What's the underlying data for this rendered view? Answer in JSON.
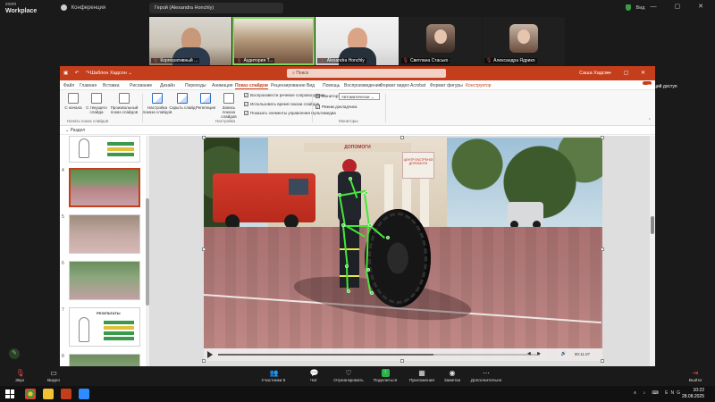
{
  "zoom": {
    "logo_line1": "zoom",
    "logo_line2": "Workplace",
    "conference_label": "Конференция",
    "speaker_label": "Герой (Alexandra Honchly)",
    "view_label": "Вид",
    "participants": [
      {
        "name": "Корпоративный ...",
        "type": "video"
      },
      {
        "name": "Аудитория Т...",
        "type": "video"
      },
      {
        "name": "Alexandra Honchly",
        "type": "video"
      },
      {
        "name": "Светлана Стасько",
        "type": "avatar"
      },
      {
        "name": "Александра Ядрико",
        "type": "avatar"
      }
    ],
    "toolbar": {
      "audio": "Звук",
      "video": "Видео",
      "participants": "Участники",
      "participants_count": "5",
      "chat": "Чат",
      "react": "Отреагировать",
      "share": "Поделиться",
      "apps": "Приложения",
      "notes": "Заметки",
      "more": "Дополнительно",
      "leave": "Выйти"
    }
  },
  "ppt": {
    "file_name": "Шаблон Хадсон ⌄",
    "search_placeholder": "Поиск",
    "user": "Саша Хадсон",
    "share_label": "Общий доступ",
    "menu": [
      "Файл",
      "Главная",
      "Вставка",
      "Рисование",
      "Дизайн",
      "Переходы",
      "Анимация",
      "Показ слайдов",
      "Рецензирование",
      "Вид",
      "Помощь",
      "Воспроизведение",
      "Формат видео",
      "Acrobat",
      "Формат фигуры",
      "Конструктор"
    ],
    "active_menu": "Показ слайдов",
    "ribbon": {
      "buttons": [
        "С начала",
        "С текущего слайда",
        "Произвольный показ слайдов",
        "Настройка показа слайдов",
        "Скрыть слайд",
        "Репетиция",
        "Запись показа слайдов"
      ],
      "group1": "Начать показ слайдов",
      "group2": "Настройка",
      "checks": [
        "Воспроизвести речевое сопровождение",
        "Использовать время показа слайдов",
        "Показать элементы управления мультимедиа"
      ],
      "monitor_label": "Монитор:",
      "monitor_value": "Автоматически",
      "presenter_check": "Режим докладчика",
      "group3": "Мониторы"
    },
    "section": "Раздел",
    "slide_numbers": [
      "",
      "4",
      "5",
      "6",
      "7",
      "8"
    ],
    "thumb_doc_title": "РЕЗУЛЬТАТЫ",
    "slide": {
      "building_sign": "ДОПОМОГИ",
      "side_sign": "ЦЕНТР ЕКСТРЕНОЇ ДОПОМОГИ",
      "video_time": "00:11.07",
      "video_progress": 0.67
    }
  },
  "taskbar": {
    "tray": "∧ ♪ ⌨ ENG",
    "time": "10:22",
    "date": "28.08.2025"
  },
  "colors": {
    "ppt_accent": "#c43e1c",
    "zoom_active": "#7cd957",
    "skeleton": "#45e63b",
    "share_green": "#2bb24c"
  }
}
